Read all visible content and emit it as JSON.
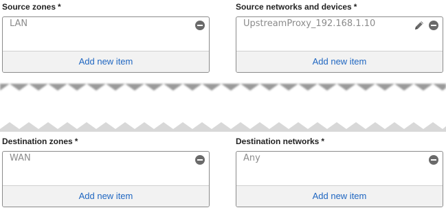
{
  "source_zones": {
    "label": "Source zones",
    "required_mark": "*",
    "items": [
      "LAN"
    ],
    "add_label": "Add new item"
  },
  "source_networks": {
    "label": "Source networks and devices",
    "required_mark": "*",
    "items": [
      "UpstreamProxy_192.168.1.10"
    ],
    "add_label": "Add new item"
  },
  "destination_zones": {
    "label": "Destination zones",
    "required_mark": "*",
    "items": [
      "WAN"
    ],
    "add_label": "Add new item"
  },
  "destination_networks": {
    "label": "Destination networks",
    "required_mark": "*",
    "items": [
      "Any"
    ],
    "add_label": "Add new item"
  },
  "colors": {
    "link": "#1f66c1",
    "placeholder_text": "#8b8b8b",
    "icon": "#6a6a6a"
  },
  "icons": [
    "remove-icon",
    "edit-icon"
  ]
}
